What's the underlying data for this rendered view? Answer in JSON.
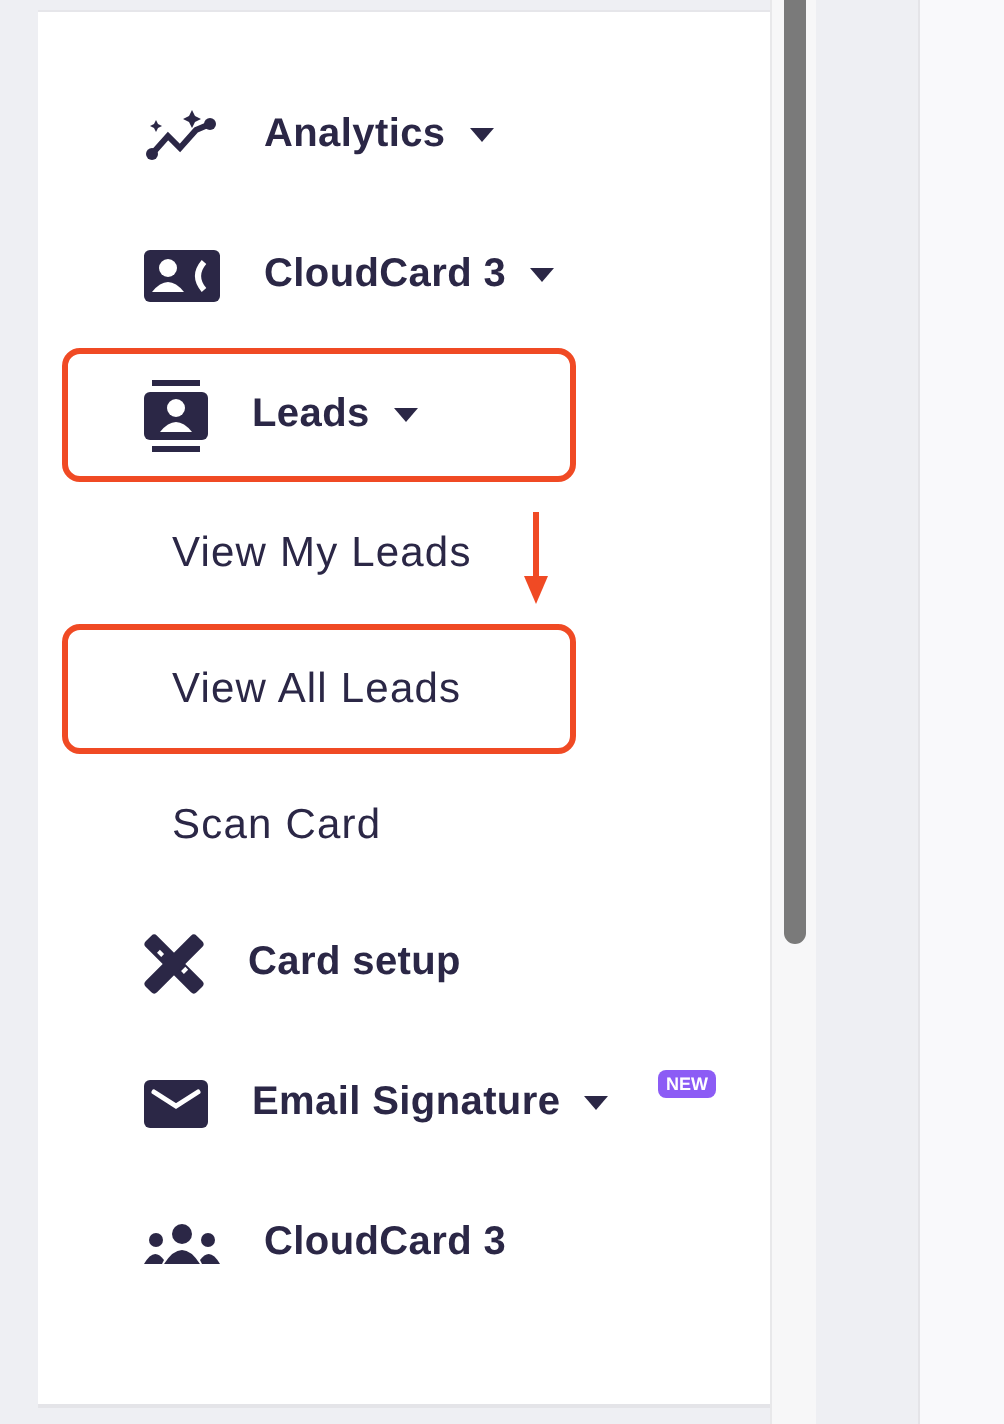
{
  "sidebar": {
    "items": [
      {
        "label": "Analytics",
        "has_dropdown": true,
        "highlighted": false
      },
      {
        "label": "CloudCard 3",
        "has_dropdown": true,
        "highlighted": false
      },
      {
        "label": "Leads",
        "has_dropdown": true,
        "highlighted": true,
        "expanded": true,
        "children": [
          {
            "label": "View My Leads",
            "highlighted": false
          },
          {
            "label": "View All Leads",
            "highlighted": true
          },
          {
            "label": "Scan Card",
            "highlighted": false
          }
        ]
      },
      {
        "label": "Card setup",
        "has_dropdown": false,
        "highlighted": false
      },
      {
        "label": "Email Signature",
        "has_dropdown": true,
        "highlighted": false,
        "badge": "NEW"
      },
      {
        "label": "CloudCard 3",
        "has_dropdown": false,
        "highlighted": false
      }
    ]
  }
}
